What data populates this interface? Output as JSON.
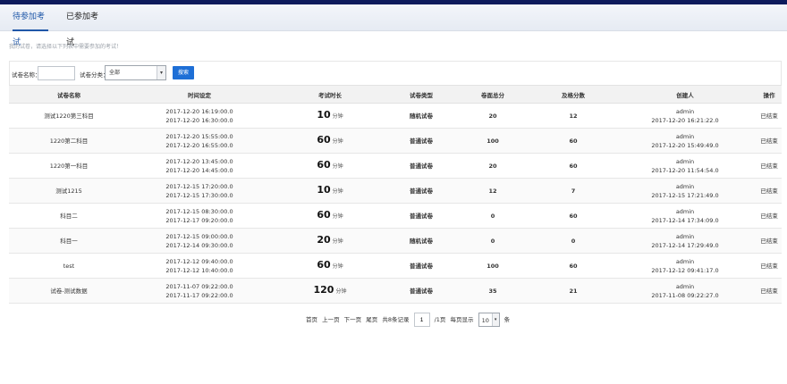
{
  "tabs": [
    {
      "label": "待参加考试",
      "active": true
    },
    {
      "label": "已参加考试",
      "active": false
    }
  ],
  "hint": "我的试卷，请选择以下列表中需要参加的考试！",
  "filter": {
    "name_label": "试卷名称：",
    "name_value": "",
    "type_label": "试卷分类：",
    "type_value": "全部",
    "search_label": "搜索"
  },
  "table": {
    "headers": [
      "试卷名称",
      "时间设定",
      "考试时长",
      "试卷类型",
      "卷面总分",
      "及格分数",
      "创建人",
      "操作"
    ],
    "rows": [
      {
        "name": "测试1220第三科目",
        "start": "2017-12-20 16:19:00.0",
        "end": "2017-12-20 16:30:00.0",
        "duration": "10",
        "unit": "分钟",
        "type": "随机试卷",
        "total": "20",
        "pass": "12",
        "creator": "admin",
        "created": "2017-12-20 16:21:22.0",
        "action": "已结束"
      },
      {
        "name": "1220第二科目",
        "start": "2017-12-20 15:55:00.0",
        "end": "2017-12-20 16:55:00.0",
        "duration": "60",
        "unit": "分钟",
        "type": "普通试卷",
        "total": "100",
        "pass": "60",
        "creator": "admin",
        "created": "2017-12-20 15:49:49.0",
        "action": "已结束"
      },
      {
        "name": "1220第一科目",
        "start": "2017-12-20 13:45:00.0",
        "end": "2017-12-20 14:45:00.0",
        "duration": "60",
        "unit": "分钟",
        "type": "普通试卷",
        "total": "20",
        "pass": "60",
        "creator": "admin",
        "created": "2017-12-20 11:54:54.0",
        "action": "已结束"
      },
      {
        "name": "测试1215",
        "start": "2017-12-15 17:20:00.0",
        "end": "2017-12-15 17:30:00.0",
        "duration": "10",
        "unit": "分钟",
        "type": "普通试卷",
        "total": "12",
        "pass": "7",
        "creator": "admin",
        "created": "2017-12-15 17:21:49.0",
        "action": "已结束"
      },
      {
        "name": "科目二",
        "start": "2017-12-15 08:30:00.0",
        "end": "2017-12-17 09:20:00.0",
        "duration": "60",
        "unit": "分钟",
        "type": "普通试卷",
        "total": "0",
        "pass": "60",
        "creator": "admin",
        "created": "2017-12-14 17:34:09.0",
        "action": "已结束"
      },
      {
        "name": "科目一",
        "start": "2017-12-15 09:00:00.0",
        "end": "2017-12-14 09:30:00.0",
        "duration": "20",
        "unit": "分钟",
        "type": "随机试卷",
        "total": "0",
        "pass": "0",
        "creator": "admin",
        "created": "2017-12-14 17:29:49.0",
        "action": "已结束"
      },
      {
        "name": "test",
        "start": "2017-12-12 09:40:00.0",
        "end": "2017-12-12 10:40:00.0",
        "duration": "60",
        "unit": "分钟",
        "type": "普通试卷",
        "total": "100",
        "pass": "60",
        "creator": "admin",
        "created": "2017-12-12 09:41:17.0",
        "action": "已结束"
      },
      {
        "name": "试卷-测试数据",
        "start": "2017-11-07 09:22:00.0",
        "end": "2017-11-17 09:22:00.0",
        "duration": "120",
        "unit": "分钟",
        "type": "普通试卷",
        "total": "35",
        "pass": "21",
        "creator": "admin",
        "created": "2017-11-08 09:22:27.0",
        "action": "已结束"
      }
    ]
  },
  "pager": {
    "first": "首页",
    "prev": "上一页",
    "next": "下一页",
    "last": "尾页",
    "total_prefix": "共8条记录",
    "page_value": "1",
    "page_suffix": "/1页",
    "size_prefix": "每页显示",
    "size_value": "10",
    "size_suffix": "条"
  },
  "colors": {
    "accent": "#1f57a8",
    "topbar": "#0d1a5c",
    "button": "#1e6fd6"
  },
  "icons": {
    "select_arrow": "chevron-down-icon"
  }
}
